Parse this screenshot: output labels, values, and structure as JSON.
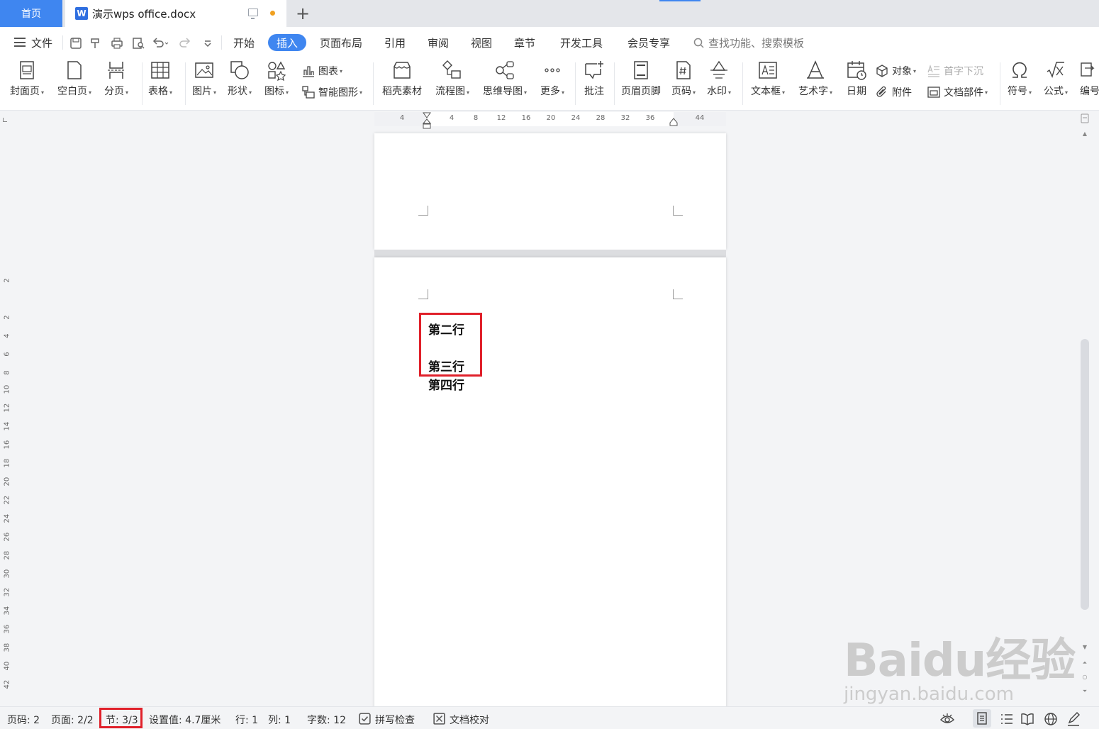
{
  "tabs": {
    "home": "首页",
    "doc_title": "演示wps office.docx",
    "doc_icon": "W",
    "new_tab": "+"
  },
  "menu": {
    "file": "文件",
    "items": [
      "开始",
      "插入",
      "页面布局",
      "引用",
      "审阅",
      "视图",
      "章节",
      "开发工具",
      "会员专享"
    ],
    "active": "插入",
    "search_placeholder": "查找功能、搜索模板"
  },
  "ribbon": {
    "cover": "封面页",
    "blank": "空白页",
    "pagebreak": "分页",
    "table": "表格",
    "picture": "图片",
    "shape": "形状",
    "icons": "图标",
    "chart": "图表",
    "smartart": "智能图形",
    "material": "稻壳素材",
    "flowchart": "流程图",
    "mindmap": "思维导图",
    "more": "更多",
    "comment": "批注",
    "headerfooter": "页眉页脚",
    "pagenum": "页码",
    "watermark": "水印",
    "textbox": "文本框",
    "wordart": "艺术字",
    "date": "日期",
    "object": "对象",
    "attachment": "附件",
    "dropcap": "首字下沉",
    "docpart": "文档部件",
    "symbol": "符号",
    "formula": "公式",
    "numbering": "编号"
  },
  "hruler": [
    "4",
    "4",
    "8",
    "12",
    "16",
    "20",
    "24",
    "28",
    "32",
    "36",
    "44"
  ],
  "vruler": [
    "2",
    "2",
    "4",
    "6",
    "8",
    "10",
    "12",
    "14",
    "16",
    "18",
    "20",
    "22",
    "24",
    "26",
    "28",
    "30",
    "32",
    "34",
    "36",
    "38",
    "40",
    "42"
  ],
  "document": {
    "line2": "第二行",
    "line3": "第三行",
    "line4": "第四行"
  },
  "watermark": {
    "brand": "Baidu经验",
    "url": "jingyan.baidu.com"
  },
  "status": {
    "page_num": "页码: 2",
    "pages": "页面: 2/2",
    "section": "节: 3/3",
    "setting": "设置值: 4.7厘米",
    "row": "行: 1",
    "col": "列: 1",
    "wordcount": "字数: 12",
    "spellcheck": "拼写检查",
    "proofread": "文档校对"
  },
  "colors": {
    "accent": "#3f86f0",
    "highlight": "#e0202a"
  }
}
